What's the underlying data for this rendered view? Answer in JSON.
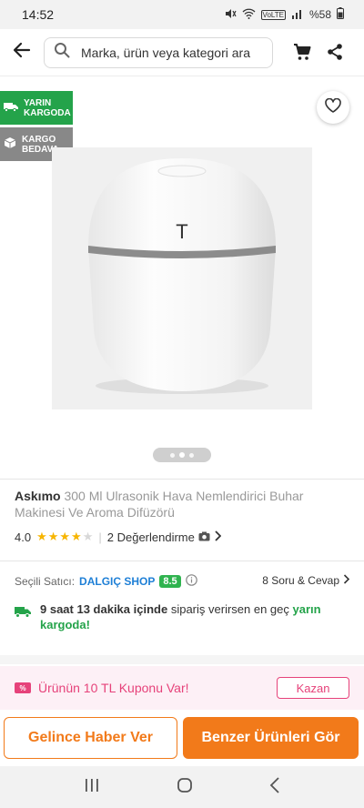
{
  "status_bar": {
    "time": "14:52",
    "battery": "%58",
    "icons": [
      "mute-icon",
      "wifi-icon",
      "volte-icon",
      "signal-icon",
      "battery-icon"
    ],
    "volte_text": "VoLTE"
  },
  "topbar": {
    "search_placeholder": "Marka, ürün veya kategori ara",
    "icons": [
      "back-arrow-icon",
      "search-icon",
      "cart-icon",
      "share-icon"
    ]
  },
  "gallery": {
    "badges": [
      {
        "line1": "YARIN",
        "line2": "KARGODA",
        "icon": "truck-icon"
      },
      {
        "line1": "KARGO",
        "line2": "BEDAVA",
        "icon": "box-icon"
      }
    ],
    "image_letter": "T",
    "dots_total": 3,
    "dots_active": 2
  },
  "product": {
    "brand": "Askımo",
    "name": "300 Ml Ulrasonik Hava Nemlendirici Buhar Makinesi Ve Aroma Difüzörü",
    "rating": "4.0",
    "stars_filled": 4,
    "stars_total": 5,
    "reviews": "2 Değerlendirme"
  },
  "seller": {
    "label": "Seçili Satıcı:",
    "name": "DALGIÇ SHOP",
    "score": "8.5",
    "qa": "8 Soru & Cevap"
  },
  "delivery": {
    "time": "9 saat 13 dakika içinde",
    "middle": "sipariş verirsen en geç",
    "highlight": "yarın kargoda!"
  },
  "coupon": {
    "icon_text": "%",
    "text": "Ürünün 10 TL Kuponu Var!",
    "button": "Kazan"
  },
  "actions": {
    "notify": "Gelince Haber Ver",
    "similar": "Benzer Ürünleri Gör"
  },
  "colors": {
    "accent_orange": "#f27a1a",
    "green": "#24a34a",
    "pink": "#e6427a",
    "seller_blue": "#1e7fd6"
  }
}
